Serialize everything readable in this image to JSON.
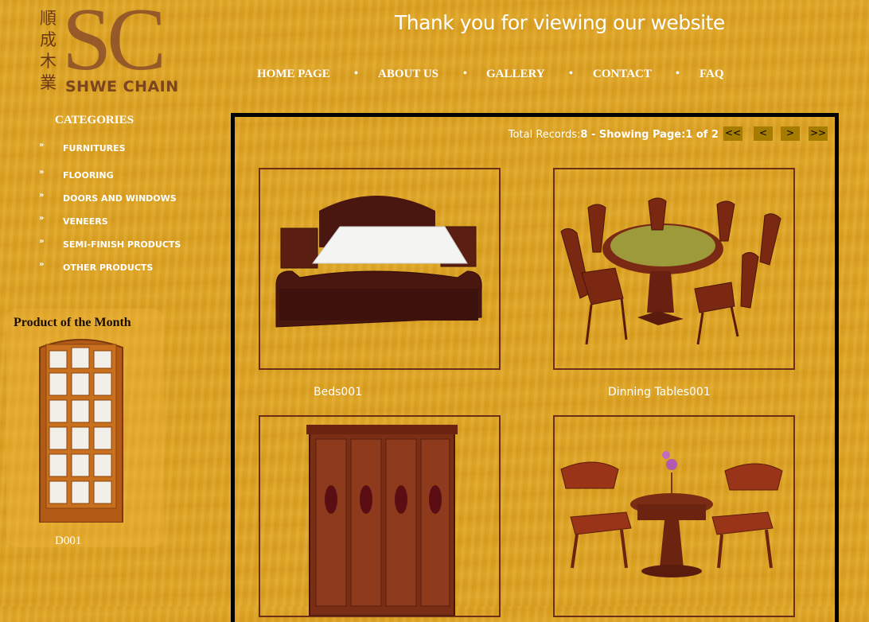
{
  "logo": {
    "cjk": [
      "順",
      "成",
      "木",
      "業"
    ],
    "mark": "SC",
    "name": "SHWE CHAIN"
  },
  "header": {
    "welcome": "Thank you for viewing our website"
  },
  "nav": {
    "items": [
      "HOME PAGE",
      "ABOUT US",
      "GALLERY",
      "CONTACT",
      "FAQ"
    ],
    "separator": "•"
  },
  "sidebar": {
    "title": "CATEGORIES",
    "bullet": "»",
    "items": [
      "FURNITURES",
      "FLOORING",
      "DOORS AND WINDOWS",
      "VENEERS",
      "SEMI-FINISH PRODUCTS",
      "OTHER PRODUCTS"
    ]
  },
  "product_of_month": {
    "title": "Product of the Month",
    "label": "D001"
  },
  "gallery": {
    "records_label": "Total Records:",
    "records_value": "8",
    "separator": " - ",
    "showing_label": "Showing Page:",
    "showing_value": "1 of 2",
    "pager": [
      "<<",
      "<",
      ">",
      ">>"
    ],
    "items": [
      {
        "label": "Beds001",
        "icon": "bed-image"
      },
      {
        "label": "Dinning Tables001",
        "icon": "dining-table-image"
      },
      {
        "label": "",
        "icon": "wardrobe-image"
      },
      {
        "label": "",
        "icon": "chairs-table-image"
      }
    ]
  },
  "colors": {
    "background": "#dca222",
    "frame": "#000000",
    "card_border": "#6b2f16",
    "wood": "#5a1f10"
  }
}
